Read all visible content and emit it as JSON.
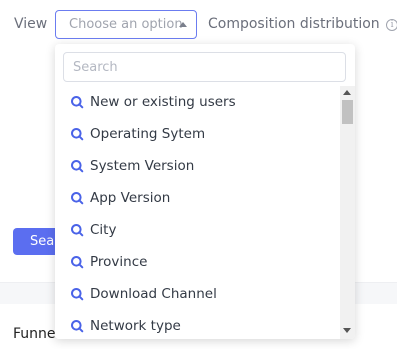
{
  "filter": {
    "view_label": "View",
    "select_placeholder": "Choose an option",
    "composition_label": "Composition distribution",
    "info_icon_glyph": "i"
  },
  "search_button": {
    "label": "Search"
  },
  "funnel": {
    "label": "Funne"
  },
  "dropdown": {
    "search_placeholder": "Search",
    "items": [
      {
        "label": "New or existing users",
        "icon": "search-query-icon"
      },
      {
        "label": "Operating Sytem",
        "icon": "search-query-icon"
      },
      {
        "label": "System Version",
        "icon": "search-query-icon"
      },
      {
        "label": "App Version",
        "icon": "search-query-icon"
      },
      {
        "label": "City",
        "icon": "search-query-icon"
      },
      {
        "label": "Province",
        "icon": "search-query-icon"
      },
      {
        "label": "Download Channel",
        "icon": "search-query-icon"
      },
      {
        "label": "Network type",
        "icon": "search-query-icon"
      }
    ]
  },
  "colors": {
    "accent": "#5b6ef0",
    "select_border": "#6b7cf0",
    "item_icon": "#4a63e8"
  }
}
